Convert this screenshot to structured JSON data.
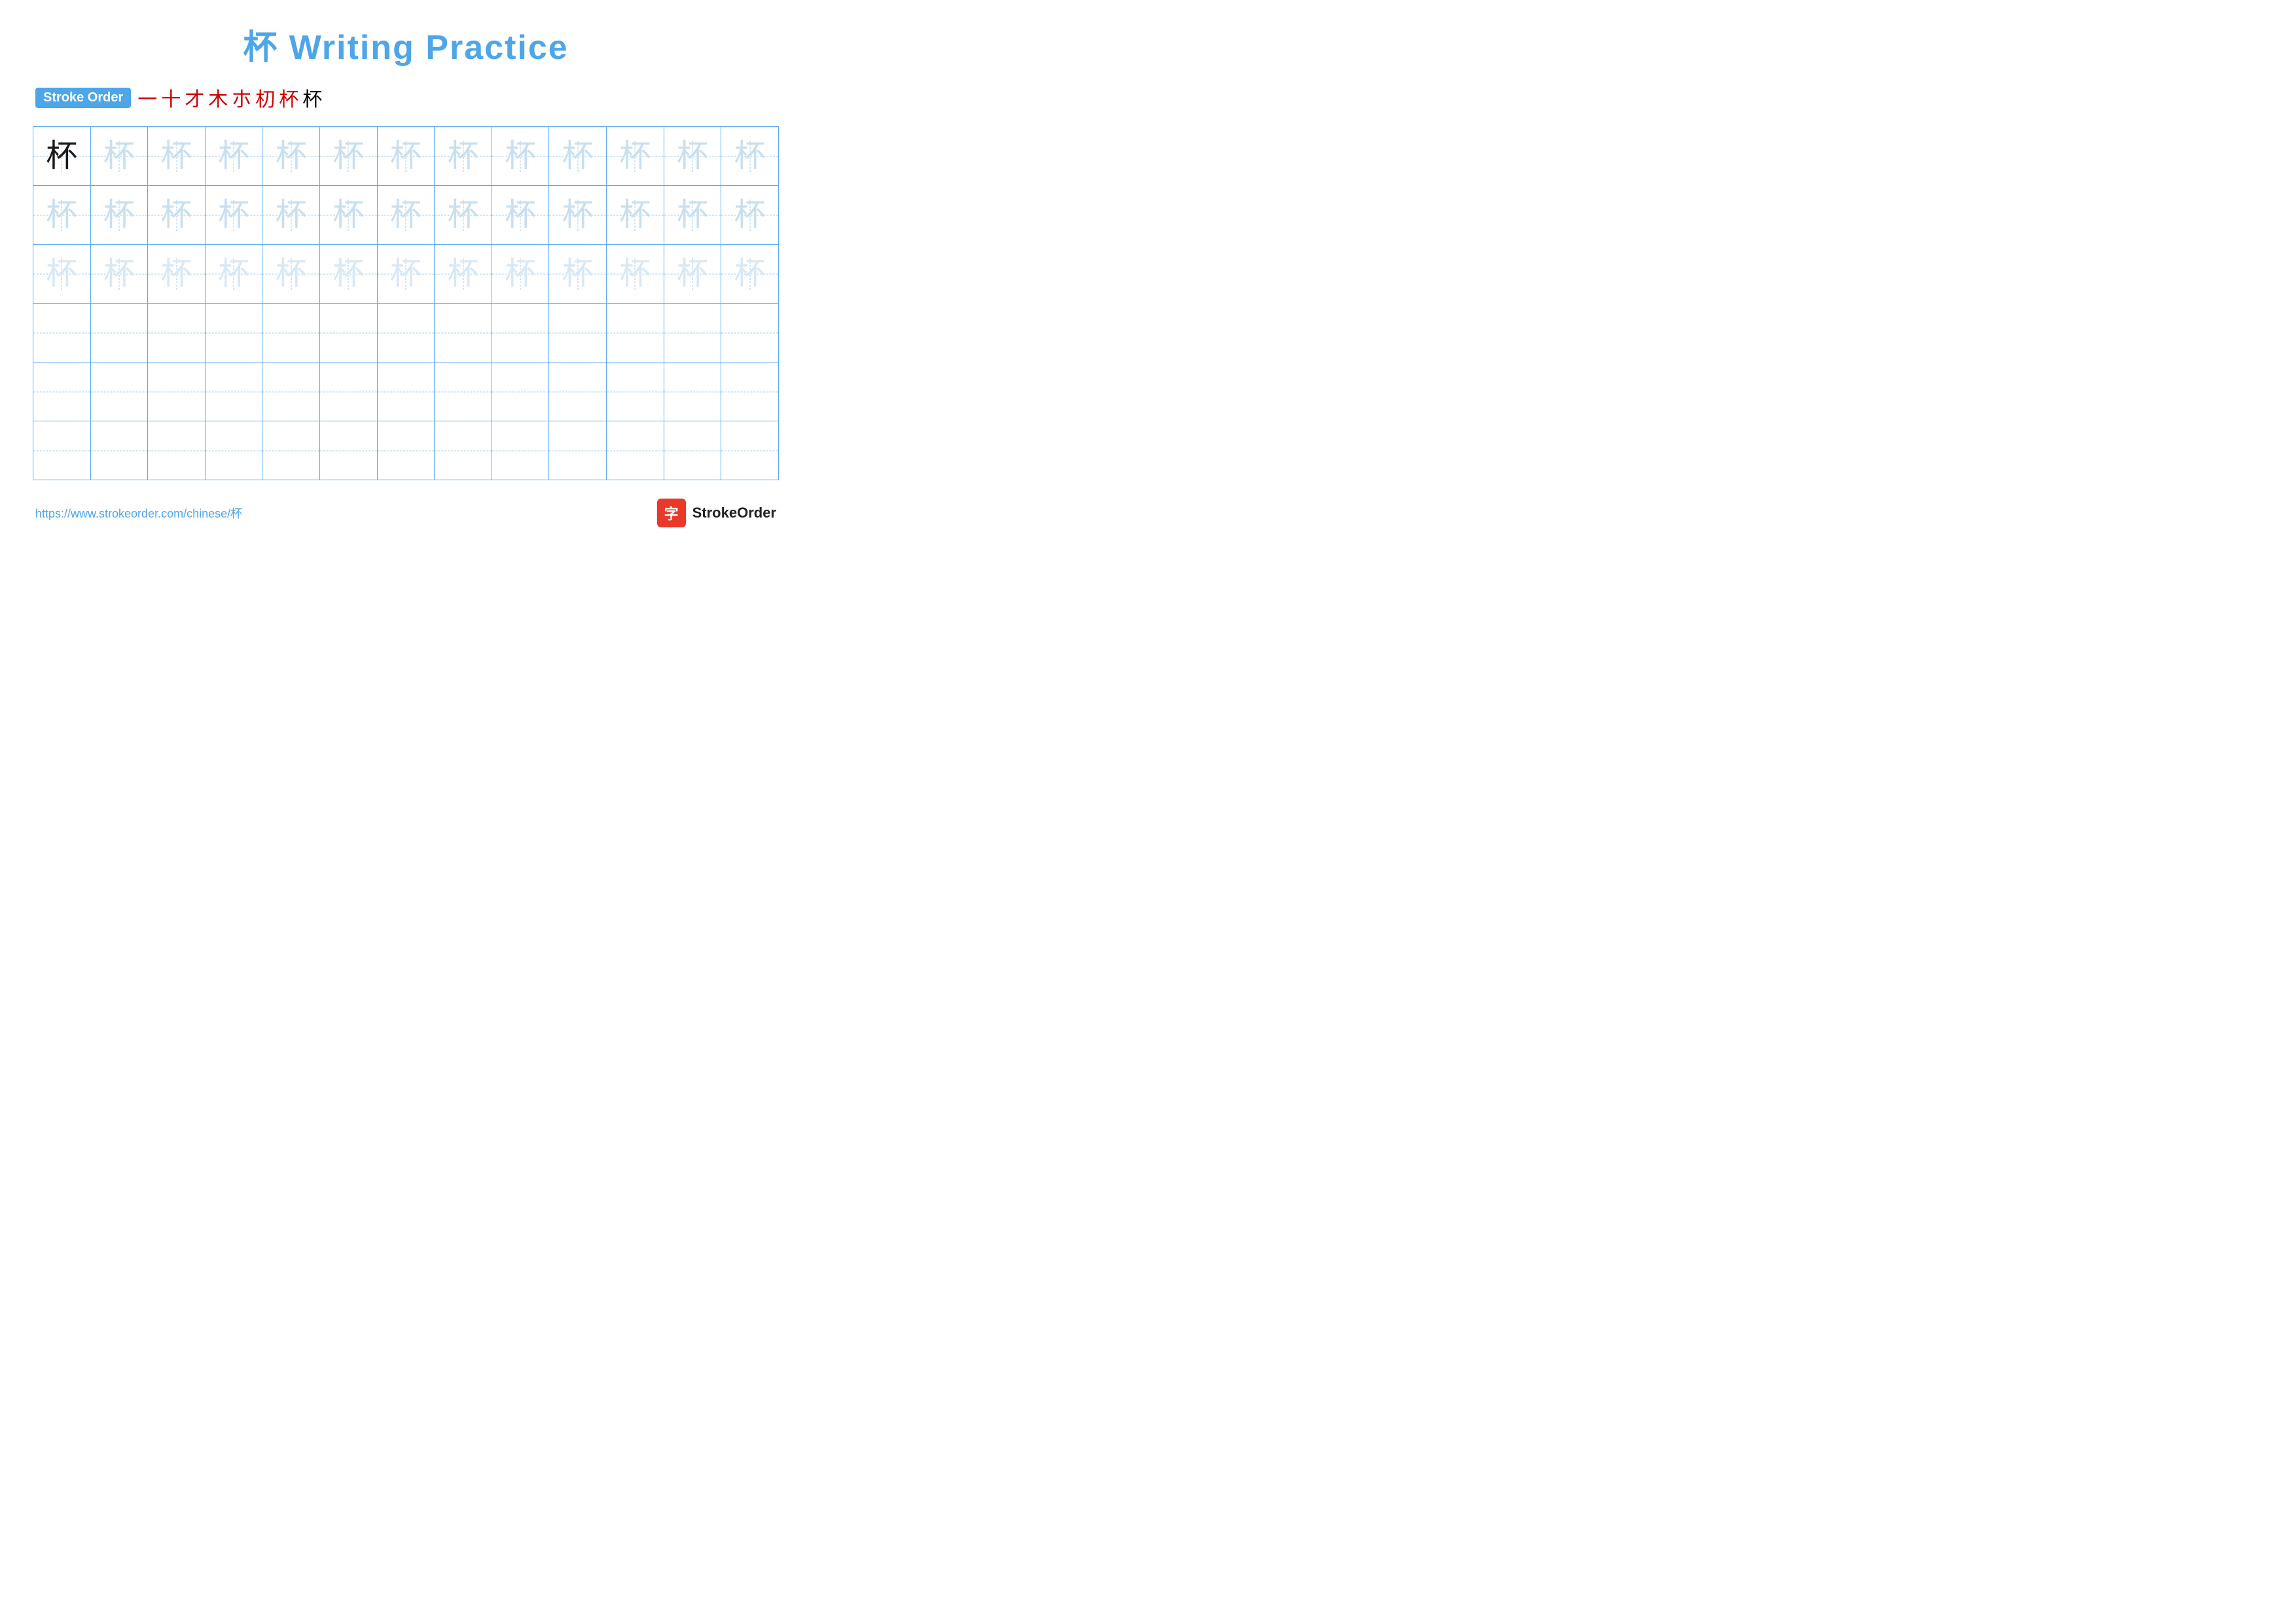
{
  "title": "杯 Writing Practice",
  "stroke_order": {
    "badge_label": "Stroke Order",
    "steps": [
      "一",
      "十",
      "才",
      "木",
      "朩",
      "朷",
      "杯",
      "杯"
    ]
  },
  "grid": {
    "rows": 6,
    "cols": 13,
    "character": "杯",
    "row_types": [
      "dark_then_light",
      "light",
      "lighter",
      "empty",
      "empty",
      "empty"
    ]
  },
  "footer": {
    "url": "https://www.strokeorder.com/chinese/杯",
    "brand_name": "StrokeOrder",
    "logo_char": "字"
  }
}
